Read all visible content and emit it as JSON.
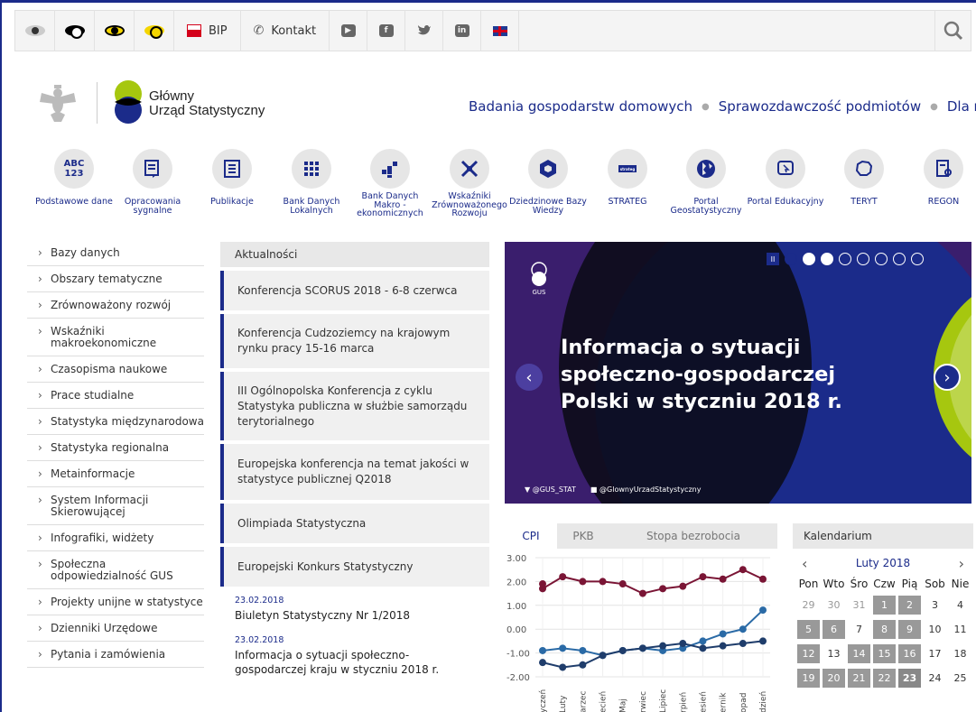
{
  "topbar": {
    "bip_label": "BIP",
    "contact_label": "Kontakt",
    "social_icons": [
      "youtube-icon",
      "facebook-icon",
      "twitter-icon",
      "linkedin-icon"
    ],
    "lang_icon": "uk-flag-icon"
  },
  "logo": {
    "line1": "Główny",
    "line2": "Urząd Statystyczny"
  },
  "main_nav": [
    "Badania gospodarstw domowych",
    "Sprawozdawczość podmiotów",
    "Dla mediów"
  ],
  "icon_row": [
    {
      "label": "Podstawowe dane",
      "icon": "abc-123-icon",
      "glyph": "ABC 123"
    },
    {
      "label": "Opracowania sygnalne",
      "icon": "document-icon"
    },
    {
      "label": "Publikacje",
      "icon": "publication-icon"
    },
    {
      "label": "Bank Danych Lokalnych",
      "icon": "grid-icon"
    },
    {
      "label": "Bank Danych Makro - ekonomicznych",
      "icon": "blocks-icon"
    },
    {
      "label": "Wskaźniki Zrównoważonego Rozwoju",
      "icon": "arrows-icon"
    },
    {
      "label": "Dziedzinowe Bazy Wiedzy",
      "icon": "hexagon-icon"
    },
    {
      "label": "STRATEG",
      "icon": "strateg-icon"
    },
    {
      "label": "Portal Geostatystyczny",
      "icon": "globe-icon"
    },
    {
      "label": "Portal Edukacyjny",
      "icon": "edu-icon"
    },
    {
      "label": "TERYT",
      "icon": "poland-map-icon"
    },
    {
      "label": "REGON",
      "icon": "regon-icon"
    }
  ],
  "left_menu": [
    "Bazy danych",
    "Obszary tematyczne",
    "Zrównoważony rozwój",
    "Wskaźniki makroekonomiczne",
    "Czasopisma naukowe",
    "Prace studialne",
    "Statystyka międzynarodowa",
    "Statystyka regionalna",
    "Metainformacje",
    "System Informacji Skierowującej",
    "Infografiki, widżety",
    "Społeczna odpowiedzialność GUS",
    "Projekty unijne w statystyce",
    "Dzienniki Urzędowe",
    "Pytania i zamówienia"
  ],
  "news": {
    "header": "Aktualności",
    "items": [
      "Konferencja SCORUS 2018 - 6-8 czerwca",
      "Konferencja Cudzoziemcy na krajowym rynku pracy 15-16 marca",
      "III Ogólnopolska Konferencja z cyklu Statystyka publiczna w służbie samorządu terytorialnego",
      "Europejska konferencja na temat jakości w statystyce publicznej Q2018",
      "Olimpiada Statystyczna",
      "Europejski Konkurs Statystyczny"
    ],
    "dated": [
      {
        "date": "23.02.2018",
        "title": "Biuletyn Statystyczny Nr 1/2018"
      },
      {
        "date": "23.02.2018",
        "title": "Informacja o sytuacji społeczno-gospodarczej kraju w styczniu 2018 r."
      }
    ]
  },
  "slider": {
    "title": "Informacja o sytuacji społeczno-gospodarczej Polski w styczniu 2018 r.",
    "gus_label": "GUS",
    "twitter": "@GUS_STAT",
    "facebook": "@GlownyUrzadStatystyczny",
    "pause_glyph": "II",
    "dots": 8,
    "active_dot": 0,
    "filled_dots": [
      1,
      2
    ]
  },
  "chart_panel": {
    "tabs": [
      "CPI",
      "PKB",
      "Stopa bezrobocia"
    ],
    "active_tab": 0
  },
  "chart_data": {
    "type": "line",
    "categories": [
      "Styczeń",
      "Luty",
      "Marzec",
      "Kwiecień",
      "Maj",
      "Czerwiec",
      "Lipiec",
      "Sierpień",
      "Wrzesień",
      "Październik",
      "Listopad",
      "Grudzień"
    ],
    "tick_labels": [
      "yczeń",
      "Luty",
      "arzec",
      "ecień",
      "Maj",
      "rwiec",
      "Lipiec",
      "rpień",
      "esień",
      "ernik",
      "opad",
      "dzień"
    ],
    "ylim": [
      -2.0,
      3.0
    ],
    "yticks": [
      "3.00",
      "2.00",
      "1.00",
      "0.00",
      "-1.00",
      "-2.00"
    ],
    "grid": true,
    "colors": [
      "#7a1535",
      "#2a6aa6",
      "#1f3d6b"
    ],
    "series": [
      {
        "values": [
          1.7,
          2.2,
          2.0,
          2.0,
          1.9,
          1.5,
          1.7,
          1.8,
          2.2,
          2.1,
          2.5,
          2.1
        ]
      },
      {
        "values": [
          -0.9,
          -0.8,
          -0.9,
          -1.1,
          -0.9,
          -0.8,
          -0.9,
          -0.8,
          -0.5,
          -0.2,
          0.0,
          0.8
        ]
      },
      {
        "values": [
          -1.4,
          -1.6,
          -1.5,
          -1.1,
          -0.9,
          -0.8,
          -0.7,
          -0.6,
          -0.8,
          -0.7,
          -0.6,
          -0.5
        ]
      }
    ],
    "extra_point": {
      "series": 0,
      "index": 0,
      "value": 1.9
    }
  },
  "calendar": {
    "header": "Kalendarium",
    "month": "Luty 2018",
    "prev": "‹",
    "next": "›",
    "dow": [
      "Pon",
      "Wto",
      "Śro",
      "Czw",
      "Pią",
      "Sob",
      "Nie"
    ],
    "weeks": [
      [
        {
          "d": "29",
          "t": "out"
        },
        {
          "d": "30",
          "t": "out"
        },
        {
          "d": "31",
          "t": "out"
        },
        {
          "d": "1",
          "t": "ev"
        },
        {
          "d": "2",
          "t": "ev"
        },
        {
          "d": "3",
          "t": ""
        },
        {
          "d": "4",
          "t": ""
        }
      ],
      [
        {
          "d": "5",
          "t": "ev"
        },
        {
          "d": "6",
          "t": "ev"
        },
        {
          "d": "7",
          "t": ""
        },
        {
          "d": "8",
          "t": "ev"
        },
        {
          "d": "9",
          "t": "ev"
        },
        {
          "d": "10",
          "t": ""
        },
        {
          "d": "11",
          "t": ""
        }
      ],
      [
        {
          "d": "12",
          "t": "ev"
        },
        {
          "d": "13",
          "t": ""
        },
        {
          "d": "14",
          "t": "ev"
        },
        {
          "d": "15",
          "t": "ev"
        },
        {
          "d": "16",
          "t": "ev"
        },
        {
          "d": "17",
          "t": ""
        },
        {
          "d": "18",
          "t": ""
        }
      ],
      [
        {
          "d": "19",
          "t": "ev"
        },
        {
          "d": "20",
          "t": "ev"
        },
        {
          "d": "21",
          "t": "ev"
        },
        {
          "d": "22",
          "t": "ev"
        },
        {
          "d": "23",
          "t": "today"
        },
        {
          "d": "24",
          "t": ""
        },
        {
          "d": "25",
          "t": ""
        }
      ]
    ]
  }
}
